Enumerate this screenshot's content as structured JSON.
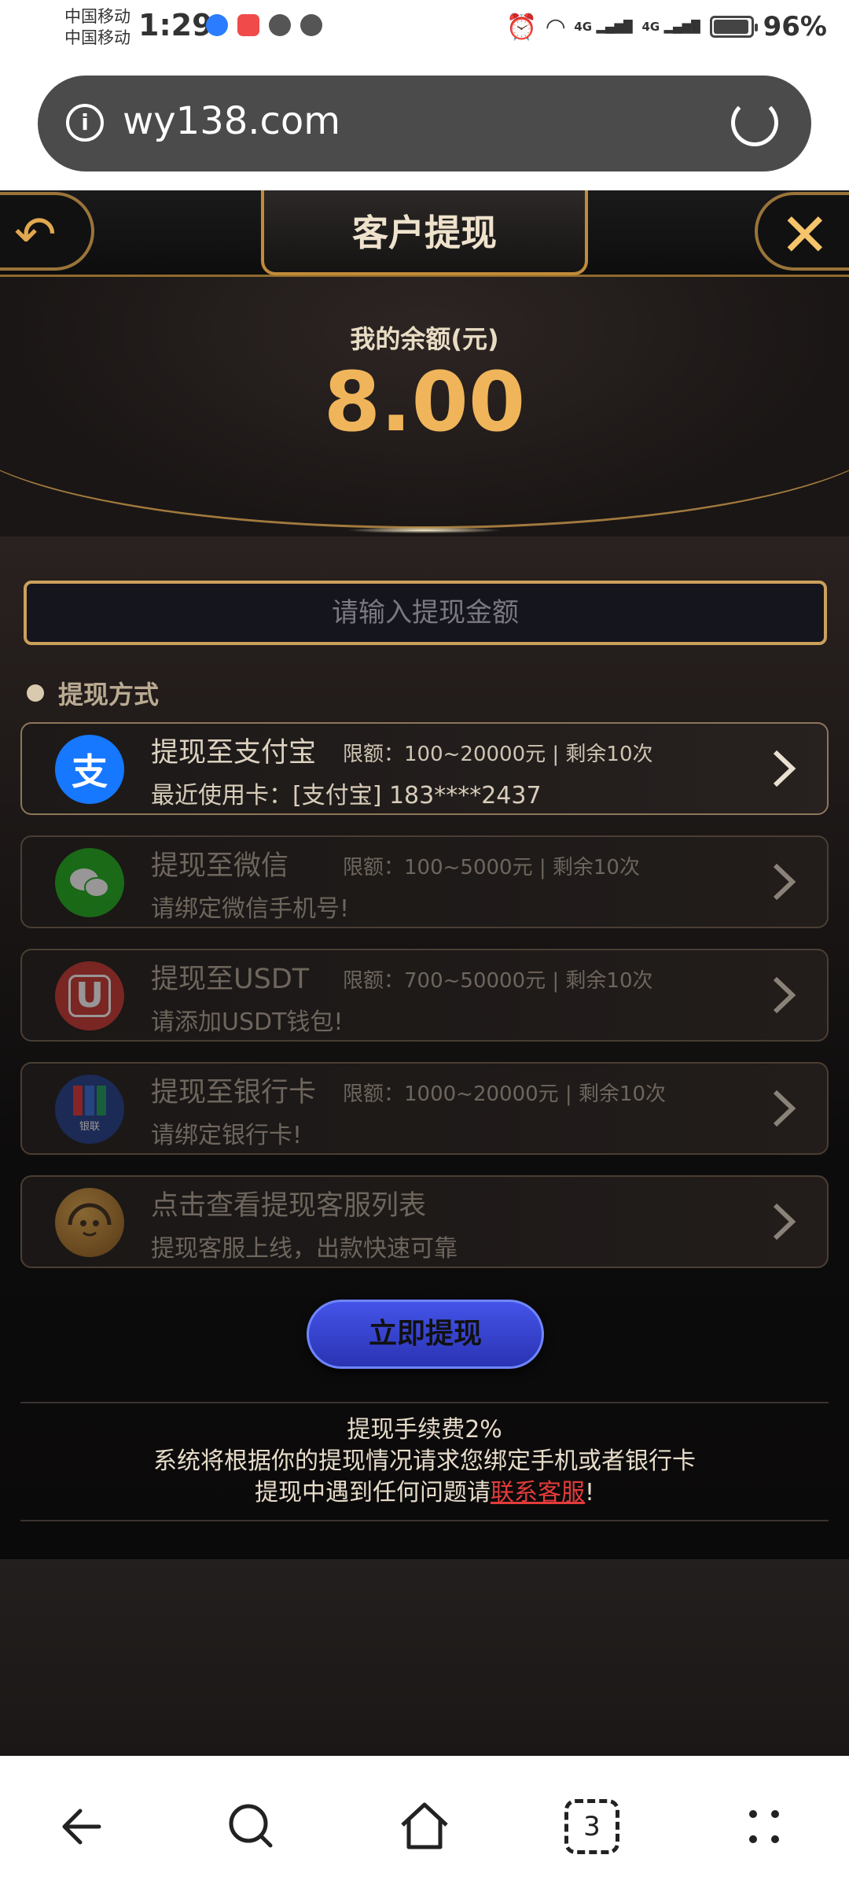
{
  "status_bar": {
    "carrier_1": "中国移动",
    "carrier_2": "中国移动",
    "time": "1:29",
    "network_1": "4G",
    "network_2": "4G",
    "battery_percent": "96%",
    "battery_level": 0.96
  },
  "browser": {
    "url": "wy138.com"
  },
  "header": {
    "title": "客户提现"
  },
  "balance": {
    "label": "我的余额(元)",
    "value": "8.00"
  },
  "amount_input": {
    "placeholder": "请输入提现金额"
  },
  "methods_section": {
    "title": "提现方式"
  },
  "methods": [
    {
      "title": "提现至支付宝",
      "limit": "限额：100~20000元 | 剩余10次",
      "subtitle": "最近使用卡：[支付宝] 183****2437",
      "icon": "alipay-icon",
      "icon_char": "支",
      "color": "#1677ff"
    },
    {
      "title": "提现至微信",
      "limit": "限额：100~5000元 | 剩余10次",
      "subtitle": "请绑定微信手机号!",
      "icon": "wechat-icon",
      "color": "#1aad19"
    },
    {
      "title": "提现至USDT",
      "limit": "限额：700~50000元 | 剩余10次",
      "subtitle": "请添加USDT钱包!",
      "icon": "usdt-icon",
      "icon_char": "U",
      "color": "#c8342e"
    },
    {
      "title": "提现至银行卡",
      "limit": "限额：1000~20000元 | 剩余10次",
      "subtitle": "请绑定银行卡!",
      "icon": "unionpay-icon",
      "icon_char": "银联",
      "color": "#1e3a8a"
    },
    {
      "title": "点击查看提现客服列表",
      "limit": "",
      "subtitle": "提现客服上线，出款快速可靠",
      "icon": "customer-service-icon",
      "color": "#c98a2c"
    }
  ],
  "submit": {
    "label": "立即提现"
  },
  "notes": {
    "line1": "提现手续费2%",
    "line2": "系统将根据你的提现情况请求您绑定手机或者银行卡",
    "line3_prefix": "提现中遇到任何问题请",
    "contact_link": "联系客服",
    "line3_suffix": "!"
  },
  "nav_bar": {
    "tab_count": "3"
  }
}
